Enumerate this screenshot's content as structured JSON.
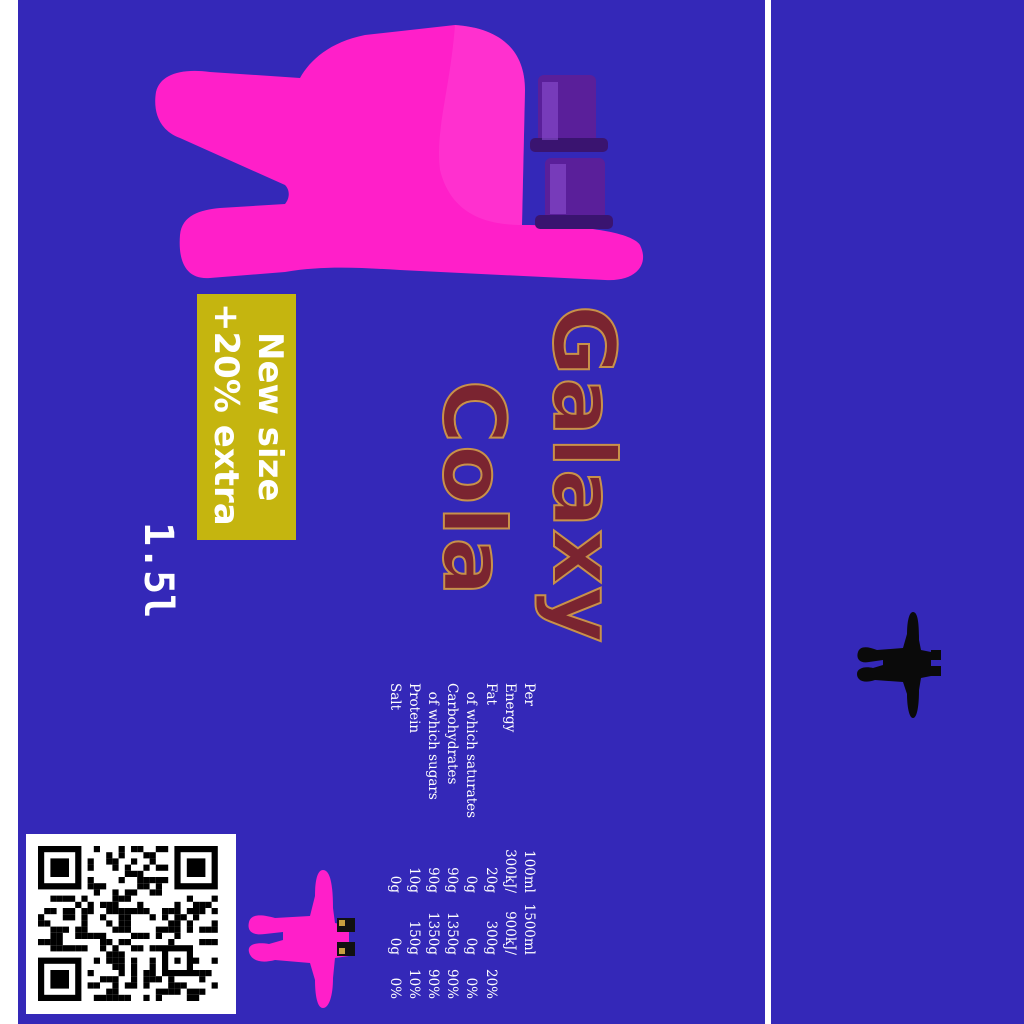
{
  "colors": {
    "background": "#3428b8",
    "brand_text": "#7a2430",
    "brand_outline": "#c8914a",
    "promo_box": "#c5b50f",
    "mascot": "#ff1fc9",
    "hat": "#5a1f9a"
  },
  "brand": {
    "line1": "Galaxy",
    "line2": "Cola"
  },
  "promo": {
    "line1": "New size",
    "line2": "+20% extra"
  },
  "volume": "1.5l",
  "nutrition": {
    "header": [
      "Per",
      "100ml",
      "1500ml"
    ],
    "rows": [
      [
        "Energy",
        "300kJ/",
        "900kJ/",
        ""
      ],
      [
        "Fat",
        "20g",
        "300g",
        "20%"
      ],
      [
        "  of which saturates",
        "0g",
        "0g",
        "0%"
      ],
      [
        "Carbohydrates",
        "90g",
        "1350g",
        "90%"
      ],
      [
        "  of which sugars",
        "90g",
        "1350g",
        "90%"
      ],
      [
        "Protein",
        "10g",
        "150g",
        "10%"
      ],
      [
        "Salt",
        "0g",
        "0g",
        "0%"
      ]
    ]
  },
  "icons": {
    "mascot": "pink-hand-mascot-icon",
    "qr": "qr-code-icon"
  }
}
